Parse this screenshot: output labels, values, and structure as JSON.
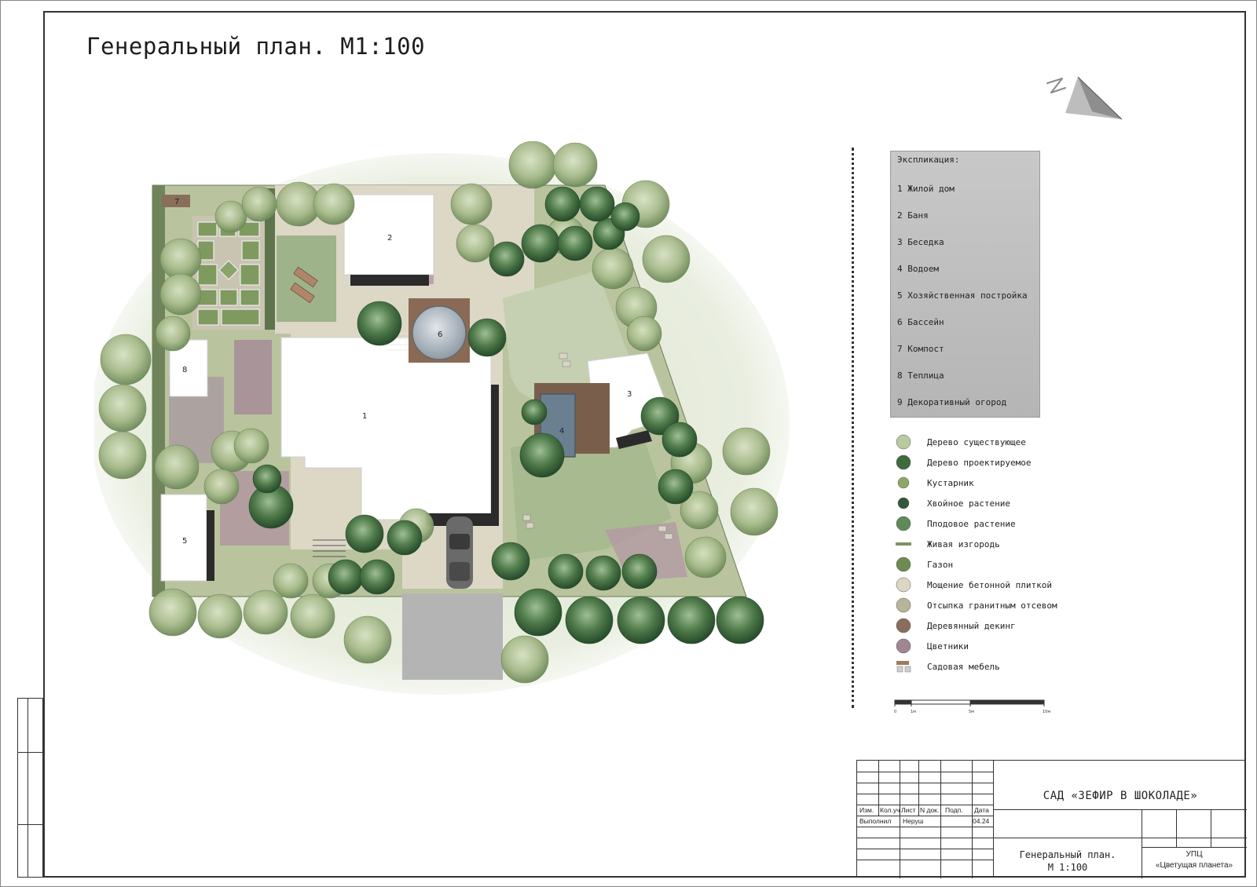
{
  "title": "Генеральный план. М1:100",
  "explication": {
    "heading": "Экспликация:",
    "items": [
      {
        "num": "1",
        "name": "Жилой дом"
      },
      {
        "num": "2",
        "name": "Баня"
      },
      {
        "num": "3",
        "name": "Беседка"
      },
      {
        "num": "4",
        "name": "Водоем"
      },
      {
        "num": "5",
        "name": "Хозяйственная постройка"
      },
      {
        "num": "6",
        "name": "Бассейн"
      },
      {
        "num": "7",
        "name": "Компост"
      },
      {
        "num": "8",
        "name": "Теплица"
      },
      {
        "num": "9",
        "name": "Декоративный огород"
      }
    ]
  },
  "legend": [
    {
      "label": "Дерево существующее",
      "swatch": "existing-tree",
      "color": "#b9c9a0"
    },
    {
      "label": "Дерево проектируемое",
      "swatch": "designed-tree",
      "color": "#3f6a3c"
    },
    {
      "label": "Кустарник",
      "swatch": "shrub",
      "color": "#8fa86a"
    },
    {
      "label": "Хвойное растение",
      "swatch": "conifer",
      "color": "#33573a"
    },
    {
      "label": "Плодовое растение",
      "swatch": "fruit-plant",
      "color": "#5e8a57"
    },
    {
      "label": "Живая изгородь",
      "swatch": "hedge",
      "color": "#7f9268"
    },
    {
      "label": "Газон",
      "swatch": "lawn",
      "color": "#6f8a52"
    },
    {
      "label": "Мощение бетонной плиткой",
      "swatch": "concrete-paving",
      "color": "#dcd6c4"
    },
    {
      "label": "Отсыпка гранитным отсевом",
      "swatch": "granite-gravel",
      "color": "#b7b49a"
    },
    {
      "label": "Деревянный декинг",
      "swatch": "wood-decking",
      "color": "#8a6e5c"
    },
    {
      "label": "Цветники",
      "swatch": "flowerbeds",
      "color": "#9f8690"
    },
    {
      "label": "Садовая мебель",
      "swatch": "garden-furniture",
      "color": "#a07a5a"
    }
  ],
  "scale_labels": [
    "0",
    "1м",
    "5м",
    "10м"
  ],
  "plan_labels": {
    "house": "1",
    "bathhouse": "2",
    "gazebo": "3",
    "pond": "4",
    "utility": "5",
    "pool": "6",
    "compost": "7",
    "greenhouse": "8"
  },
  "title_block": {
    "project": "САД «ЗЕФИР В ШОКОЛАДЕ»",
    "headers": [
      "Изм.",
      "Кол.уч",
      "Лист",
      "N док.",
      "Подп.",
      "Дата"
    ],
    "performed_label": "Выполнил",
    "performer": "Неруш",
    "date": "04.24",
    "sheet_name_line1": "Генеральный план.",
    "sheet_name_line2": "М 1:100",
    "org_line1": "УПЦ",
    "org_line2": "«Цветущая планета»"
  }
}
